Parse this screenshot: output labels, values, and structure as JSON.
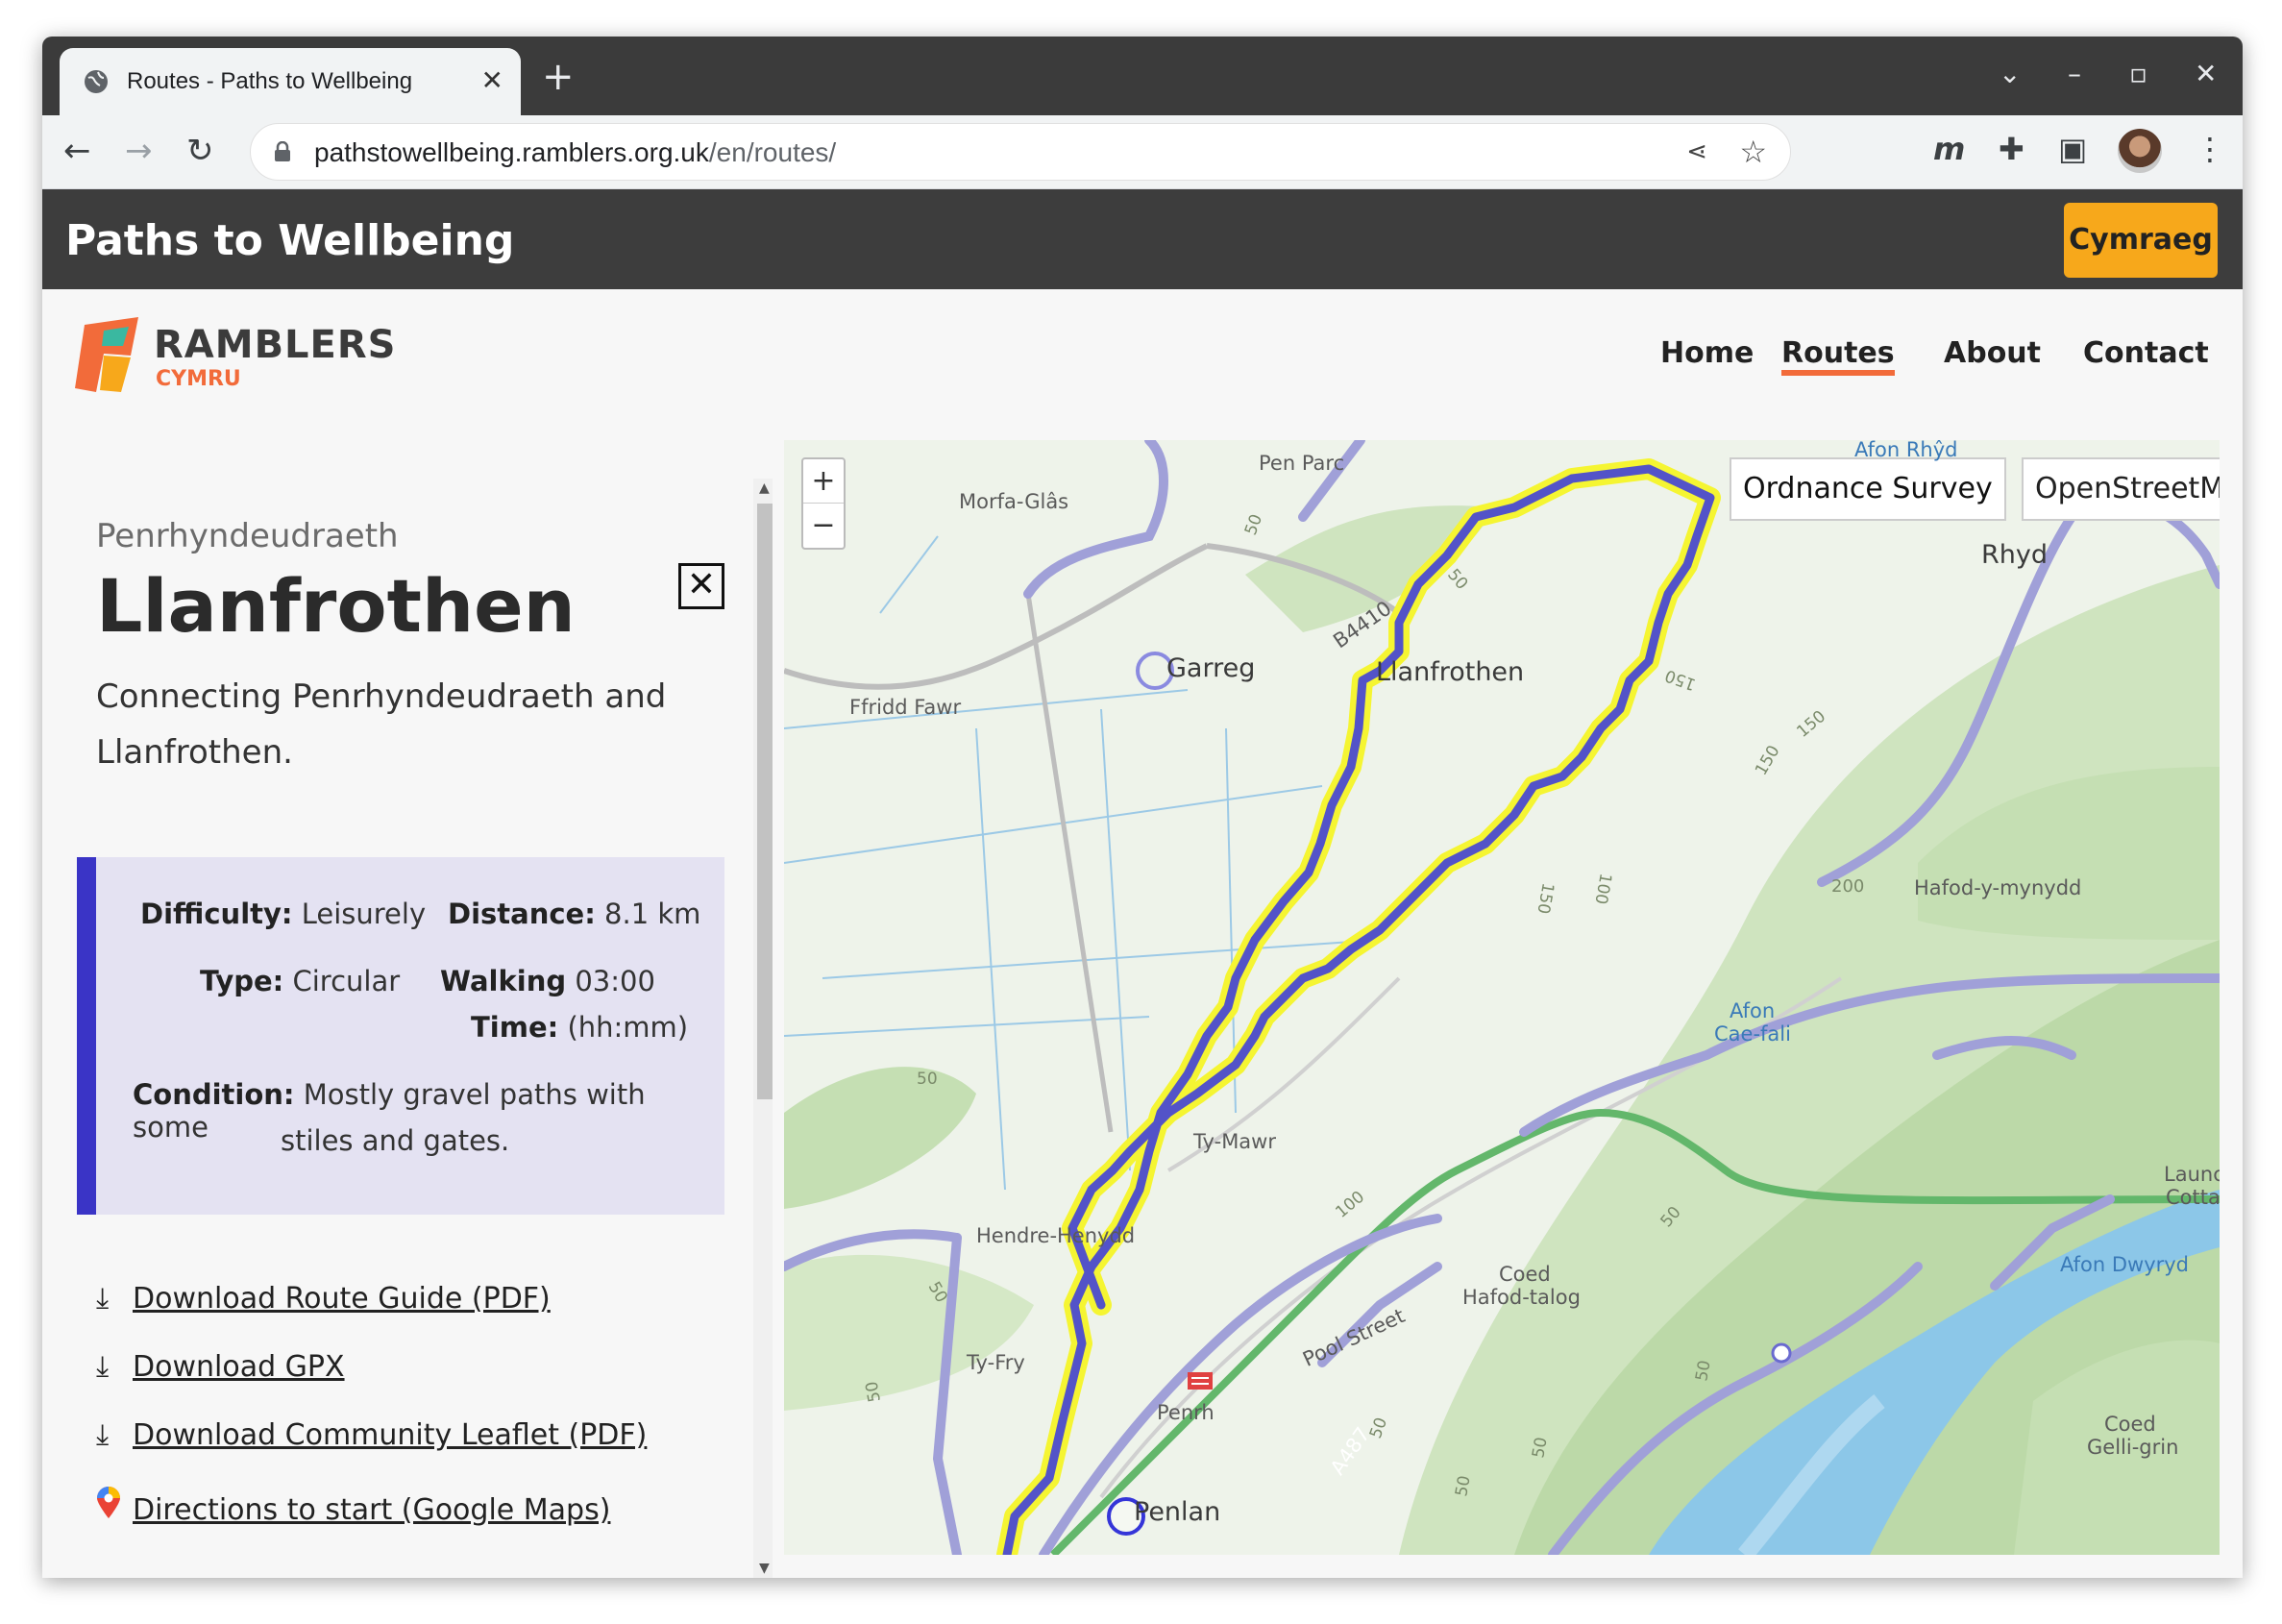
{
  "browser": {
    "tab_title": "Routes - Paths to Wellbeing",
    "url_host": "pathstowellbeing.ramblers.org.uk",
    "url_path": "/en/routes/"
  },
  "site": {
    "brand": "Paths to Wellbeing",
    "language_button": "Cymraeg",
    "logo_word": "RAMBLERS",
    "logo_sub": "CYMRU",
    "nav": [
      "Home",
      "Routes",
      "About",
      "Contact"
    ],
    "active_nav": "Routes"
  },
  "route": {
    "area": "Penrhyndeudraeth",
    "title": "Llanfrothen",
    "description": "Connecting Penrhyndeudraeth and Llanfrothen.",
    "difficulty_label": "Difficulty:",
    "difficulty": "Leisurely",
    "distance_label": "Distance:",
    "distance": "8.1 km",
    "type_label": "Type:",
    "type": "Circular",
    "walking_label_1": "Walking",
    "walking_label_2": "Time:",
    "walking_time": "03:00",
    "walking_unit": "(hh:mm)",
    "condition_label": "Condition:",
    "condition_1": "Mostly gravel paths with some",
    "condition_2": "stiles and gates."
  },
  "downloads": [
    {
      "icon": "download-icon",
      "label": "Download Route Guide (PDF)"
    },
    {
      "icon": "download-icon",
      "label": "Download GPX"
    },
    {
      "icon": "download-icon",
      "label": "Download Community Leaflet (PDF)"
    },
    {
      "icon": "map-pin-icon",
      "label": "Directions to start (Google Maps)"
    }
  ],
  "map": {
    "zoom_in": "+",
    "zoom_out": "−",
    "layers": [
      "Ordnance Survey",
      "OpenStreetMap"
    ],
    "labels": {
      "pen_parc": "Pen Parc",
      "morfa_glas": "Morfa-Glâs",
      "afon_rhyd": "Afon Rhŷd",
      "rhyd": "Rhyd",
      "garreg": "Garreg",
      "b4410": "B4410",
      "llanfrothen": "Llanfrothen",
      "ffridd_fawr": "Ffridd Fawr",
      "hafod_y_mynydd": "Hafod-y-mynydd",
      "afon_cae_fali_1": "Afon",
      "afon_cae_fali_2": "Cae-fali",
      "ty_mawr": "Ty-Mawr",
      "hendre_henydd": "Hendre-Henydd",
      "coed_hafod_talog_1": "Coed",
      "coed_hafod_talog_2": "Hafod-talog",
      "afon_dwyryd": "Afon Dwyryd",
      "ty_fry": "Ty-Fry",
      "penrhyn": "Penrh",
      "penlan": "Penlan",
      "pool_street": "Pool Street",
      "a487": "A487",
      "coed_gelli_grin_1": "Coed",
      "coed_gelli_grin_2": "Gelli-grin",
      "launc": "Launc",
      "cotta": "Cotta"
    },
    "colors": {
      "route": "#5353c8",
      "route_outline": "#f5f532",
      "footpath": "#a0a0d8",
      "road_green": "#63b76b",
      "river": "#8cc7e8",
      "woodland": "#b9d8a5"
    }
  }
}
